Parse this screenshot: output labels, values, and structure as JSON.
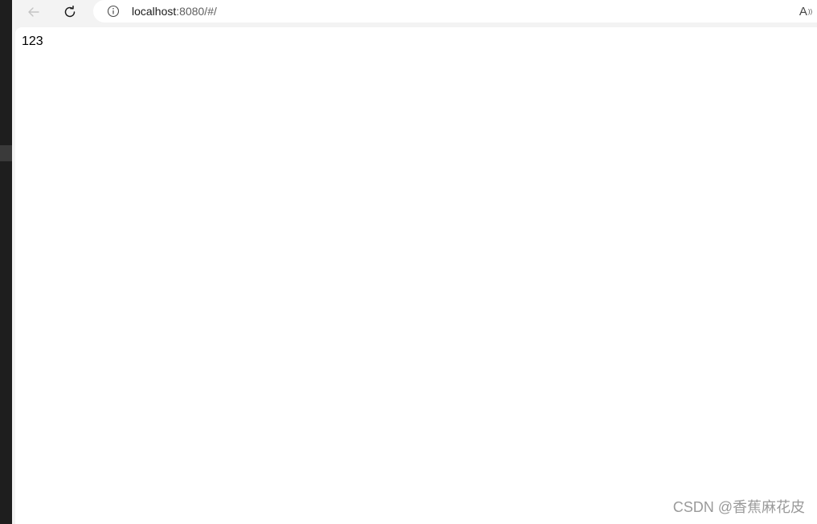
{
  "browser": {
    "url_host": "localhost",
    "url_rest": ":8080/#/",
    "read_aloud_icon": "A"
  },
  "page": {
    "body_text": "123"
  },
  "watermark": {
    "text": "CSDN @香蕉麻花皮"
  },
  "icons": {
    "back": "back-arrow-icon",
    "reload": "reload-icon",
    "info": "info-icon",
    "read_aloud": "read-aloud-icon"
  },
  "colors": {
    "chrome_bg": "#f3f3f3",
    "page_bg": "#ffffff",
    "left_strip": "#1e1e1e"
  }
}
